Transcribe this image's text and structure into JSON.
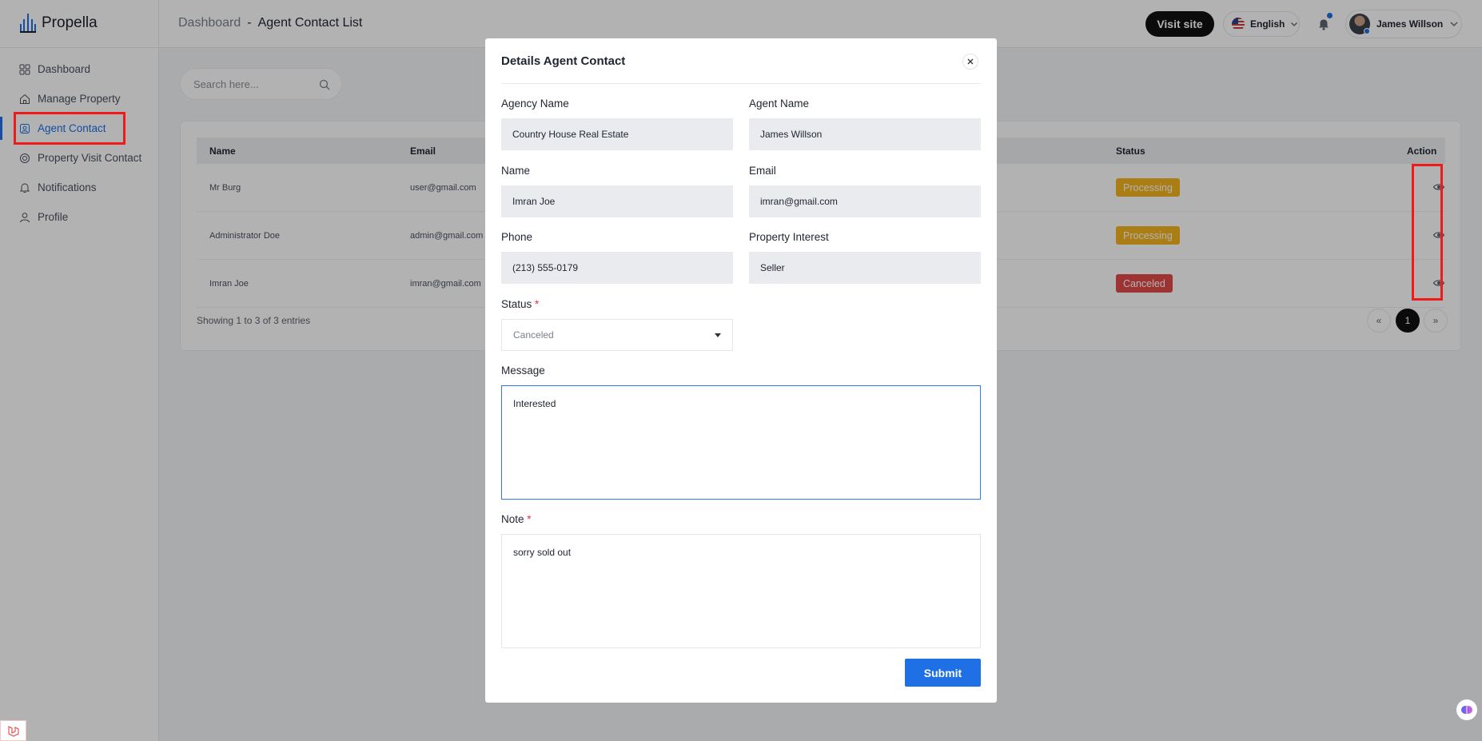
{
  "app": {
    "name": "Propella"
  },
  "sidebar": {
    "items": [
      {
        "label": "Dashboard"
      },
      {
        "label": "Manage Property"
      },
      {
        "label": "Agent Contact"
      },
      {
        "label": "Property Visit Contact"
      },
      {
        "label": "Notifications"
      },
      {
        "label": "Profile"
      }
    ],
    "active_index": 2
  },
  "header": {
    "breadcrumb_root": "Dashboard",
    "breadcrumb_sep": "-",
    "breadcrumb_current": "Agent Contact List",
    "visit_site_label": "Visit site",
    "language": "English",
    "user_name": "James Willson"
  },
  "search": {
    "placeholder": "Search here..."
  },
  "table": {
    "columns": [
      "Name",
      "Email",
      "Status",
      "Action"
    ],
    "rows": [
      {
        "name": "Mr Burg",
        "email": "user@gmail.com",
        "status": "Processing"
      },
      {
        "name": "Administrator Doe",
        "email": "admin@gmail.com",
        "status": "Processing"
      },
      {
        "name": "Imran Joe",
        "email": "imran@gmail.com",
        "status": "Canceled"
      }
    ],
    "showing": "Showing 1 to 3 of 3 entries",
    "pagination": {
      "prev": "«",
      "current": "1",
      "next": "»"
    }
  },
  "modal": {
    "title": "Details Agent Contact",
    "agency_name_label": "Agency Name",
    "agency_name": "Country House Real Estate",
    "agent_name_label": "Agent Name",
    "agent_name": "James Willson",
    "name_label": "Name",
    "name": "Imran Joe",
    "email_label": "Email",
    "email": "imran@gmail.com",
    "phone_label": "Phone",
    "phone": "(213) 555-0179",
    "interest_label": "Property Interest",
    "interest": "Seller",
    "status_label": "Status",
    "required_mark": "*",
    "status": "Canceled",
    "message_label": "Message",
    "message": "Interested",
    "note_label": "Note",
    "note": "sorry sold out",
    "submit_label": "Submit"
  },
  "colors": {
    "accent": "#1f6fe5",
    "processing": "#f4b51f",
    "canceled": "#e24949",
    "highlight": "#ef1b1b"
  }
}
